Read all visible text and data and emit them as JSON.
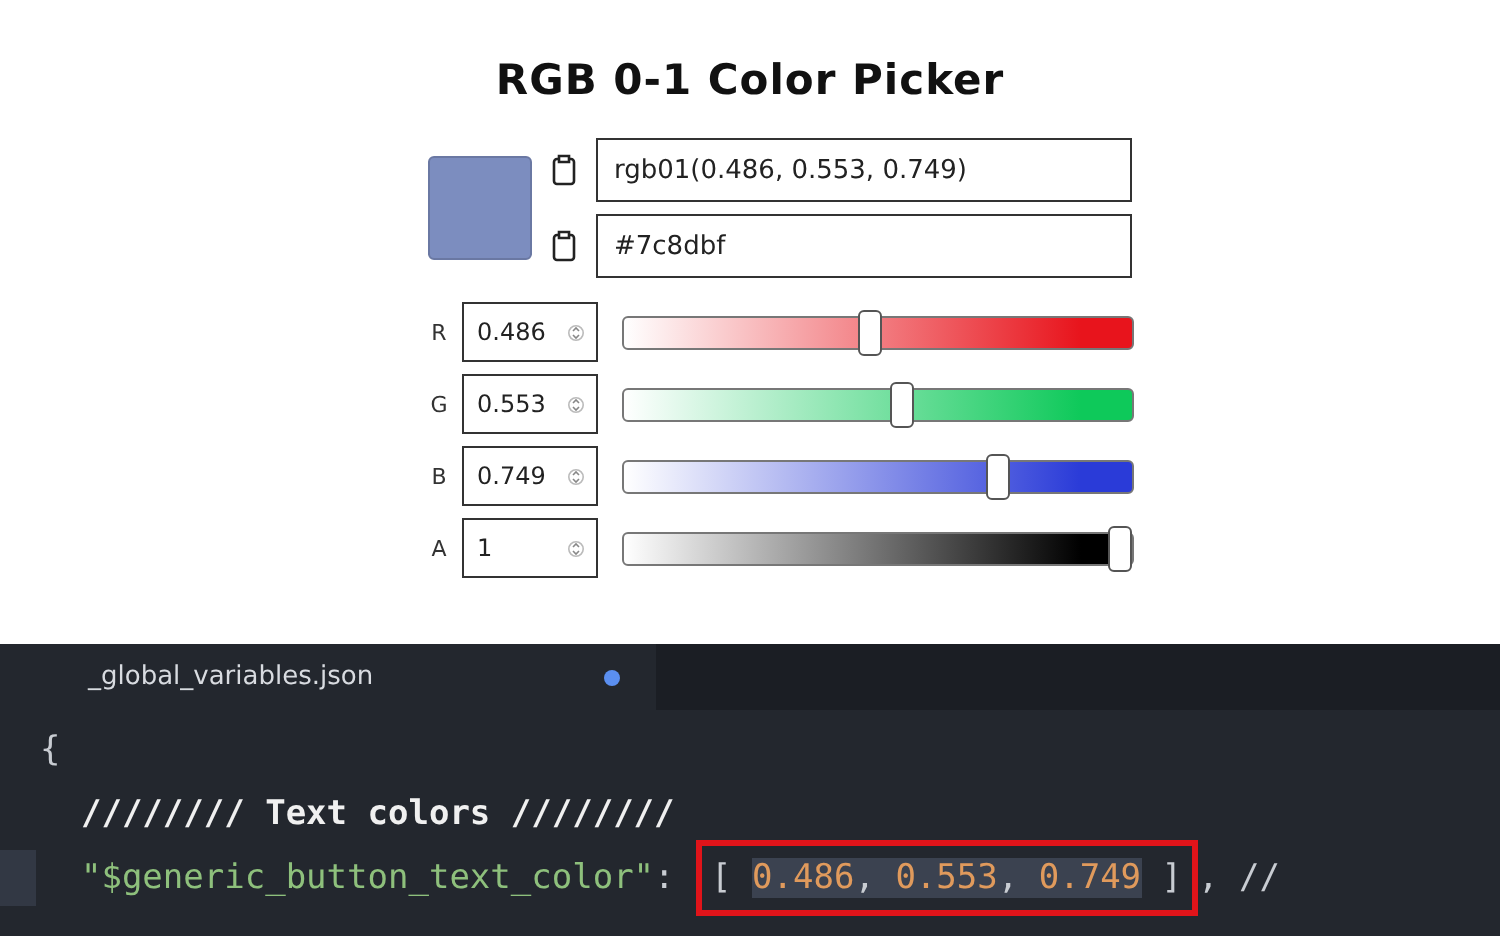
{
  "title": "RGB 0-1 Color Picker",
  "swatch": {
    "color": "#7c8dbf"
  },
  "fields": [
    {
      "value": "rgb01(0.486, 0.553, 0.749)"
    },
    {
      "value": "#7c8dbf"
    }
  ],
  "channels": [
    {
      "label": "R",
      "value": "0.486",
      "level": 0.486,
      "color": "#e8141c"
    },
    {
      "label": "G",
      "value": "0.553",
      "level": 0.553,
      "color": "#0ec95a"
    },
    {
      "label": "B",
      "value": "0.749",
      "level": 0.749,
      "color": "#2a3bd8"
    },
    {
      "label": "A",
      "value": "1",
      "level": 1,
      "color": "#000000"
    }
  ],
  "editor": {
    "tab": {
      "title": "_global_variables.json",
      "modified": true
    },
    "lines": [
      {
        "current": false,
        "parts": [
          {
            "kind": "punct",
            "text": "{"
          }
        ]
      },
      {
        "current": false,
        "parts": [
          {
            "kind": "comment",
            "text": "  //////// Text colors ////////"
          }
        ]
      },
      {
        "current": true,
        "parts": [
          {
            "kind": "string",
            "text": "  \"$generic_button_text_color\""
          },
          {
            "kind": "punct",
            "text": ": "
          },
          {
            "kind": "boxed",
            "parts": [
              {
                "kind": "punct",
                "text": "[ "
              },
              {
                "kind": "selection",
                "parts": [
                  {
                    "kind": "number",
                    "text": "0.486"
                  },
                  {
                    "kind": "punct",
                    "text": ", "
                  },
                  {
                    "kind": "number",
                    "text": "0.553"
                  },
                  {
                    "kind": "punct",
                    "text": ", "
                  },
                  {
                    "kind": "number",
                    "text": "0.749"
                  }
                ]
              },
              {
                "kind": "punct",
                "text": " ]"
              }
            ]
          },
          {
            "kind": "punct",
            "text": ", //"
          }
        ]
      }
    ]
  }
}
